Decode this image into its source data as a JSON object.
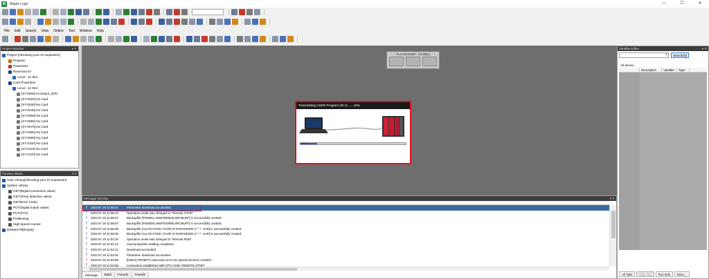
{
  "window": {
    "title": "Maple Logic",
    "minimize": "—",
    "maximize": "☐",
    "close": "✕"
  },
  "menu": [
    "File",
    "Edit",
    "Search",
    "View",
    "Online",
    "Tool",
    "Window",
    "Help"
  ],
  "project_window": {
    "title": "Project Window",
    "tree": [
      {
        "label": "Project [Allocating your IO expansion]",
        "indent": 0,
        "icon": "project-icon",
        "color": "#2255aa"
      },
      {
        "label": "Program",
        "indent": 1,
        "icon": "program-icon",
        "color": "#cc6611"
      },
      {
        "label": "Parameter",
        "indent": 1,
        "icon": "parameter-icon",
        "color": "#cc2222"
      },
      {
        "label": "Reserved IO",
        "indent": 1,
        "icon": "reserved-io-icon",
        "color": "#1f3f8f"
      },
      {
        "label": "Local : 12 Slot",
        "indent": 2,
        "icon": "slot-icon",
        "color": "#2a66bb"
      },
      {
        "label": "Card Properties",
        "indent": 1,
        "icon": "card-properties-icon",
        "color": "#1f3f8f"
      },
      {
        "label": "Local : 12 Slot",
        "indent": 2,
        "icon": "slot-icon",
        "color": "#2a66bb"
      },
      {
        "label": "[XY:0000] In.Output_32P(",
        "indent": 3,
        "icon": "card-icon",
        "color": "#777777"
      },
      {
        "label": "[XY:0020] No Card",
        "indent": 3,
        "icon": "card-icon",
        "color": "#777777"
      },
      {
        "label": "[XY:0030] No Card",
        "indent": 3,
        "icon": "card-icon",
        "color": "#777777"
      },
      {
        "label": "[XY:0040] No Card",
        "indent": 3,
        "icon": "card-icon",
        "color": "#777777"
      },
      {
        "label": "[XY:0050] No Card",
        "indent": 3,
        "icon": "card-icon",
        "color": "#777777"
      },
      {
        "label": "[XY:0060] No Card",
        "indent": 3,
        "icon": "card-icon",
        "color": "#777777"
      },
      {
        "label": "[XY:0070] No Card",
        "indent": 3,
        "icon": "card-icon",
        "color": "#777777"
      },
      {
        "label": "[XY:0080] No Card",
        "indent": 3,
        "icon": "card-icon",
        "color": "#777777"
      },
      {
        "label": "[XY:0090] No Card",
        "indent": 3,
        "icon": "card-icon",
        "color": "#777777"
      },
      {
        "label": "[XY:0100] No Card",
        "indent": 3,
        "icon": "card-icon",
        "color": "#777777"
      },
      {
        "label": "[XY:0110] No Card",
        "indent": 3,
        "icon": "card-icon",
        "color": "#777777"
      },
      {
        "label": "[XY:0120] No Card",
        "indent": 3,
        "icon": "card-icon",
        "color": "#777777"
      }
    ]
  },
  "function_block": {
    "title": "Function Block",
    "tree": [
      {
        "label": "User Library[Allocating your IO expansion]",
        "indent": 0,
        "icon": "user-library-icon",
        "color": "#2255aa"
      },
      {
        "label": "System Library",
        "indent": 0,
        "icon": "system-library-icon",
        "color": "#2255aa"
      },
      {
        "label": "GET(Digital conversion value)",
        "indent": 1,
        "icon": "fb-icon",
        "color": "#555555"
      },
      {
        "label": "GET(Temp detection value)",
        "indent": 1,
        "icon": "fb-icon",
        "color": "#555555"
      },
      {
        "label": "GET(Error Code)",
        "indent": 1,
        "icon": "fb-icon",
        "color": "#555555"
      },
      {
        "label": "PUT(Digital output value)",
        "indent": 1,
        "icon": "fb-icon",
        "color": "#555555"
      },
      {
        "label": "PUT(ETC)",
        "indent": 1,
        "icon": "fb-icon",
        "color": "#555555"
      },
      {
        "label": "Positioning",
        "indent": 1,
        "icon": "fb-icon",
        "color": "#555555"
      },
      {
        "label": "High-speed counter",
        "indent": 1,
        "icon": "fb-icon",
        "color": "#555555"
      },
      {
        "label": "Deleted FB(Empty)",
        "indent": 0,
        "icon": "deleted-fb-icon",
        "color": "#2255aa"
      }
    ]
  },
  "workspace": {
    "plc_label": "PLC-ES1616P : V6.30[C]",
    "slots": [
      "-",
      "-",
      "-"
    ],
    "dialog": {
      "title": "Transmitting USER Program (ID:1) ......16%",
      "progress": 0.16
    }
  },
  "message_window": {
    "title": "Message Window",
    "rows": [
      {
        "mark": "!",
        "time": "2023.07.19 11:59:21",
        "text": "Parameter download succeeded.",
        "selected": true,
        "mark_color": "#ffffff"
      },
      {
        "mark": "!",
        "time": "2023.07.19 11:58:42",
        "text": "Operation mode was changed to \"Remote STOP\"",
        "selected": false,
        "mark_color": "#1a2a8a"
      },
      {
        "mark": "!",
        "time": "2023.07.19 11:58:07",
        "text": "Backupfile [PGM001.16697925545.SRCBUFF] is successfully created.",
        "selected": false,
        "mark_color": "#1a2a8a"
      },
      {
        "mark": "!",
        "time": "2023.07.19 11:58:07",
        "text": "Backupfile [PGM000.16697918085.SRCBUFF] is successfully created.",
        "selected": false,
        "mark_color": "#1a2a8a"
      },
      {
        "mark": "!",
        "time": "2023.07.19 11:58:05",
        "text": "Backupfile [ALLOCATING YOUR IO EXPANSION.1* * * .VAR] is successfully created.",
        "selected": false,
        "mark_color": "#1a2a8a"
      },
      {
        "mark": "!",
        "time": "2023.07.19 11:58:05",
        "text": "Backupfile [ALLOCATING YOUR IO EXPANSION.1* * * .VAR] is successfully created.",
        "selected": false,
        "mark_color": "#1a2a8a"
      },
      {
        "mark": "!",
        "time": "2023.07.19 11:54:30",
        "text": "Operation mode was changed to \"Remote RUN\"",
        "selected": false,
        "mark_color": "#1a2a8a"
      },
      {
        "mark": "!",
        "time": "2023.07.19 11:54:12",
        "text": "Card properties reading completed.",
        "selected": false,
        "mark_color": "#1a2a8a"
      },
      {
        "mark": "!",
        "time": "2023.07.19 11:54:11",
        "text": "Download succeeded.",
        "selected": false,
        "mark_color": "#1a2a8a"
      },
      {
        "mark": "!",
        "time": "2023.07.19 11:54:02",
        "text": "Parameter download succeeded.",
        "selected": false,
        "mark_color": "#1a2a8a"
      },
      {
        "mark": "!",
        "time": "2023.07.19 11:53:59",
        "text": "[D3EC] FROMTO instruction error (no special function module)",
        "selected": false,
        "mark_color": "#cc1111"
      },
      {
        "mark": "!",
        "time": "2023.07.19 11:53:59",
        "text": "Connection established with CPU (USB, REMOTE STOP)",
        "selected": false,
        "mark_color": "#1a2a8a"
      }
    ],
    "tabs": [
      "Message",
      "Build",
      "Found1",
      "Found2"
    ]
  },
  "variable_editor": {
    "title": "Variable Editor",
    "search_label": "Search(S)",
    "tab": "All device",
    "columns": [
      "",
      "Description",
      "Variable",
      "Type"
    ],
    "buttons": [
      "All Tabs",
      "Reg. Tab",
      "Run-Edit",
      "More..."
    ]
  },
  "colors": {
    "selected_row": "#3b6aa0",
    "highlight_border": "#e01020",
    "workspace_bg": "#6e6e6e",
    "panel_title_bg": "#3c3c3c"
  }
}
